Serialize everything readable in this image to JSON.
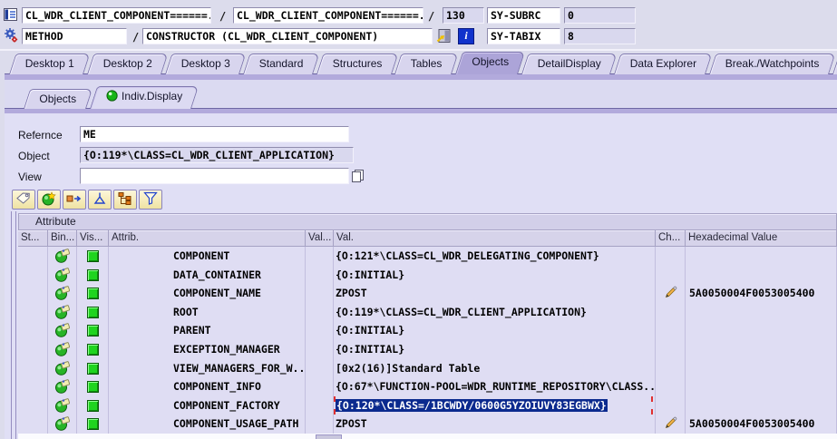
{
  "header": {
    "separator": "/",
    "program_field": "CL_WDR_CLIENT_COMPONENT======...",
    "include_field": "CL_WDR_CLIENT_COMPONENT======...",
    "line_number": "130",
    "sy_subrc": {
      "label": "SY-SUBRC",
      "value": "0"
    },
    "event_kind": "METHOD",
    "event_detail": "CONSTRUCTOR (CL_WDR_CLIENT_COMPONENT)",
    "sy_tabix": {
      "label": "SY-TABIX",
      "value": "8"
    }
  },
  "main_tabs": [
    {
      "label": "Desktop 1"
    },
    {
      "label": "Desktop 2"
    },
    {
      "label": "Desktop 3"
    },
    {
      "label": "Standard"
    },
    {
      "label": "Structures"
    },
    {
      "label": "Tables"
    },
    {
      "label": "Objects",
      "active": true
    },
    {
      "label": "DetailDisplay"
    },
    {
      "label": "Data Explorer"
    },
    {
      "label": "Break./Watchpoints"
    }
  ],
  "sub_tabs": [
    {
      "label": "Objects"
    },
    {
      "label": "Indiv.Display",
      "active": true,
      "icon": "green-led-icon"
    }
  ],
  "form": {
    "reference": {
      "label": "Refernce",
      "value": "ME"
    },
    "object": {
      "label": "Object",
      "value": "{O:119*\\CLASS=CL_WDR_CLIENT_APPLICATION}"
    },
    "view": {
      "label": "View",
      "value": ""
    }
  },
  "toolbar": {
    "icons": [
      "display-tag-icon",
      "create-services-icon",
      "change-icon",
      "sort-icon",
      "hierarchy-display-icon",
      "filter-icon"
    ]
  },
  "titlebar_icons": [
    "source-text-icon",
    "methods-gears-icon",
    "goto-statement-icon",
    "information-icon"
  ],
  "view_field_icon": "copy-value-icon",
  "attribute_panel": {
    "title": "Attribute",
    "columns": [
      "St...",
      "Bin...",
      "Vis...",
      "Attrib.",
      "Val...",
      "Val.",
      "Ch...",
      "Hexadecimal Value"
    ],
    "rows": [
      {
        "attrib": "COMPONENT",
        "value": "{O:121*\\CLASS=CL_WDR_DELEGATING_COMPONENT}",
        "changeable": false,
        "hex": "",
        "selected": false
      },
      {
        "attrib": "DATA_CONTAINER",
        "value": "{O:INITIAL}",
        "changeable": false,
        "hex": "",
        "selected": false
      },
      {
        "attrib": "COMPONENT_NAME",
        "value": "ZPOST",
        "changeable": true,
        "hex": "5A0050004F0053005400",
        "selected": false
      },
      {
        "attrib": "ROOT",
        "value": "{O:119*\\CLASS=CL_WDR_CLIENT_APPLICATION}",
        "changeable": false,
        "hex": "",
        "selected": false
      },
      {
        "attrib": "PARENT",
        "value": "{O:INITIAL}",
        "changeable": false,
        "hex": "",
        "selected": false
      },
      {
        "attrib": "EXCEPTION_MANAGER",
        "value": "{O:INITIAL}",
        "changeable": false,
        "hex": "",
        "selected": false
      },
      {
        "attrib": "VIEW_MANAGERS_FOR_W...",
        "value": "[0x2(16)]Standard Table",
        "changeable": false,
        "hex": "",
        "selected": false
      },
      {
        "attrib": "COMPONENT_INFO",
        "value": "{O:67*\\FUNCTION-POOL=WDR_RUNTIME_REPOSITORY\\CLASS...",
        "changeable": false,
        "hex": "",
        "selected": false
      },
      {
        "attrib": "COMPONENT_FACTORY",
        "value": "{O:120*\\CLASS=/1BCWDY/0600G5YZOIUVY83EGBWX}",
        "changeable": false,
        "hex": "",
        "selected": true
      },
      {
        "attrib": "COMPONENT_USAGE_PATH",
        "value": "ZPOST",
        "changeable": true,
        "hex": "5A0050004F0053005400",
        "selected": false
      }
    ]
  },
  "colors": {
    "selection_bg": "#0b2a8e",
    "selection_corner": "#e03030",
    "led_green": "#17b517",
    "active_tab": "#aca4d8",
    "panel_lavender": "#dcdcec"
  }
}
